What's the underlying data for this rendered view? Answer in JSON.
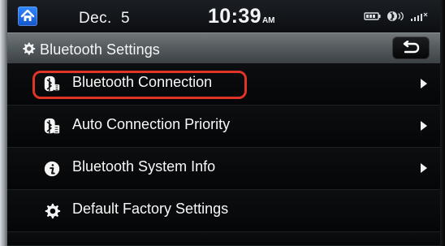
{
  "status_bar": {
    "home_icon": "home-icon",
    "date": "Dec.  5",
    "time": "10:39",
    "ampm": "AM",
    "indicators": [
      "battery-icon",
      "bluetooth-audio-icon",
      "signal-icon"
    ]
  },
  "header": {
    "icon": "gear-icon",
    "title": "Bluetooth Settings",
    "back_icon": "back-arrow-icon"
  },
  "menu": {
    "items": [
      {
        "icon": "bluetooth-connection-icon",
        "label": "Bluetooth Connection",
        "has_arrow": true,
        "highlighted": true
      },
      {
        "icon": "bluetooth-priority-icon",
        "label": "Auto Connection Priority",
        "has_arrow": true
      },
      {
        "icon": "info-icon",
        "label": "Bluetooth System Info",
        "has_arrow": true
      },
      {
        "icon": "gear-icon",
        "label": "Default Factory Settings",
        "has_arrow": false
      }
    ]
  },
  "colors": {
    "highlight_outline": "#e03427",
    "home_button": "#1f6ee8",
    "title_bar": "#5b6265"
  }
}
